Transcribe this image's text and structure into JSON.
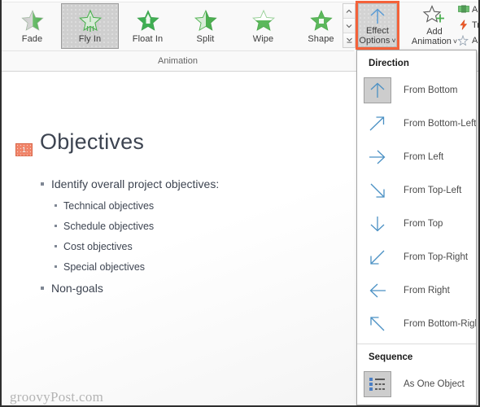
{
  "ribbon": {
    "group_label": "Animation",
    "gallery": [
      {
        "label": "Fade",
        "icon": "star-fade-icon",
        "selected": false
      },
      {
        "label": "Fly In",
        "icon": "star-flyin-icon",
        "selected": true
      },
      {
        "label": "Float In",
        "icon": "star-float-icon",
        "selected": false
      },
      {
        "label": "Split",
        "icon": "star-split-icon",
        "selected": false
      },
      {
        "label": "Wipe",
        "icon": "star-wipe-icon",
        "selected": false
      },
      {
        "label": "Shape",
        "icon": "star-shape-icon",
        "selected": false
      }
    ],
    "gallery_scroll": {
      "up": "scroll-up-icon",
      "down": "scroll-down-icon",
      "more": "more-gallery-icon"
    },
    "effect_options": {
      "line1": "Effect",
      "line2": "Options",
      "icon": "arrow-up-icon",
      "chevron": "˅",
      "highlighted": true,
      "highlight_color": "#f4623a"
    },
    "add_animation": {
      "line1": "Add",
      "line2": "Animation",
      "icon": "star-plus-icon",
      "chevron": "˅"
    },
    "advanced": [
      {
        "label": "An",
        "icon": "animation-pane-icon"
      },
      {
        "label": "Tri",
        "icon": "trigger-icon"
      },
      {
        "label": "An",
        "icon": "animation-painter-icon"
      }
    ]
  },
  "dropdown": {
    "sections": [
      {
        "title": "Direction",
        "items": [
          {
            "label": "From Bottom",
            "accel": "B",
            "icon": "arrow-up-icon",
            "active": true
          },
          {
            "label": "From Bottom-Left",
            "accel": "f",
            "icon": "arrow-up-right-icon",
            "active": false
          },
          {
            "label": "From Left",
            "accel": "L",
            "icon": "arrow-right-icon",
            "active": false
          },
          {
            "label": "From Top-Left",
            "accel": "f",
            "icon": "arrow-down-right-icon",
            "active": false
          },
          {
            "label": "From Top",
            "accel": "T",
            "icon": "arrow-down-icon",
            "active": false
          },
          {
            "label": "From Top-Right",
            "accel": "p",
            "icon": "arrow-down-left-icon",
            "active": false
          },
          {
            "label": "From Right",
            "accel": "R",
            "icon": "arrow-left-icon",
            "active": false
          },
          {
            "label": "From Bottom-Right",
            "accel": "g",
            "icon": "arrow-up-left-icon",
            "active": false
          }
        ]
      },
      {
        "title": "Sequence",
        "items": [
          {
            "label": "As One Object",
            "accel": "n",
            "icon": "as-one-object-icon",
            "active": true
          }
        ]
      }
    ]
  },
  "slide": {
    "animation_badge": "1",
    "title": "Objectives",
    "bullets": [
      {
        "level": 1,
        "text": "Identify overall project objectives:"
      },
      {
        "level": 2,
        "text": "Technical objectives"
      },
      {
        "level": 2,
        "text": "Schedule objectives"
      },
      {
        "level": 2,
        "text": "Cost objectives"
      },
      {
        "level": 2,
        "text": "Special objectives"
      },
      {
        "level": 1,
        "text": "Non-goals"
      }
    ],
    "watermark": "groovyPost.com"
  },
  "colors": {
    "accent_red": "#f4623a",
    "star_green": "#5cb85c",
    "arrow_blue": "#3f87c6",
    "badge_orange": "#f1856a"
  }
}
